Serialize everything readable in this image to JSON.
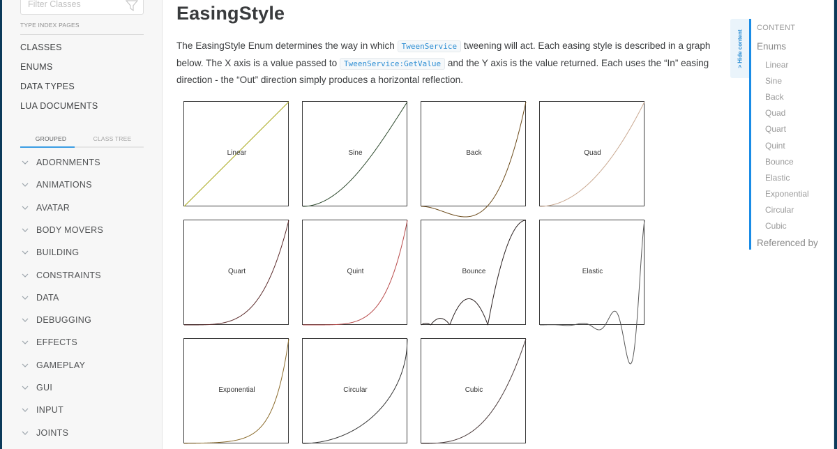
{
  "sidebar": {
    "filter_placeholder": "Filter Classes",
    "type_index_label": "TYPE INDEX PAGES",
    "top_links": [
      "CLASSES",
      "ENUMS",
      "DATA TYPES",
      "LUA DOCUMENTS"
    ],
    "tabs": [
      {
        "label": "GROUPED",
        "active": true
      },
      {
        "label": "CLASS TREE",
        "active": false
      }
    ],
    "groups": [
      "ADORNMENTS",
      "ANIMATIONS",
      "AVATAR",
      "BODY MOVERS",
      "BUILDING",
      "CONSTRAINTS",
      "DATA",
      "DEBUGGING",
      "EFFECTS",
      "GAMEPLAY",
      "GUI",
      "INPUT",
      "JOINTS"
    ]
  },
  "main": {
    "title": "EasingStyle",
    "desc": {
      "p1": "The EasingStyle Enum determines the way in which ",
      "code1": "TweenService",
      "p2": " tweening will act. Each easing style is described in a graph below. The X axis is a value passed to ",
      "code2": "TweenService:GetValue",
      "p3": " and the Y axis is the value returned. Each uses the “In” easing direction - the “Out” direction simply produces a horizontal reflection."
    },
    "graphs": [
      {
        "label": "Linear",
        "color": "#a8a81a"
      },
      {
        "label": "Sine",
        "color": "#2e4a2e"
      },
      {
        "label": "Back",
        "color": "#6b4a1a"
      },
      {
        "label": "Quad",
        "color": "#c9a890"
      },
      {
        "label": "Quart",
        "color": "#5a2a2a"
      },
      {
        "label": "Quint",
        "color": "#b84a4a"
      },
      {
        "label": "Bounce",
        "color": "#2a2020"
      },
      {
        "label": "Elastic",
        "color": "#555555"
      },
      {
        "label": "Exponential",
        "color": "#8a6a2a"
      },
      {
        "label": "Circular",
        "color": "#333333"
      },
      {
        "label": "Cubic",
        "color": "#4a3a3a"
      }
    ]
  },
  "toc": {
    "hide_label": "> Hide content",
    "header": "CONTENT",
    "section1": "Enums",
    "items": [
      "Linear",
      "Sine",
      "Back",
      "Quad",
      "Quart",
      "Quint",
      "Bounce",
      "Elastic",
      "Exponential",
      "Circular",
      "Cubic"
    ],
    "section2": "Referenced by"
  }
}
